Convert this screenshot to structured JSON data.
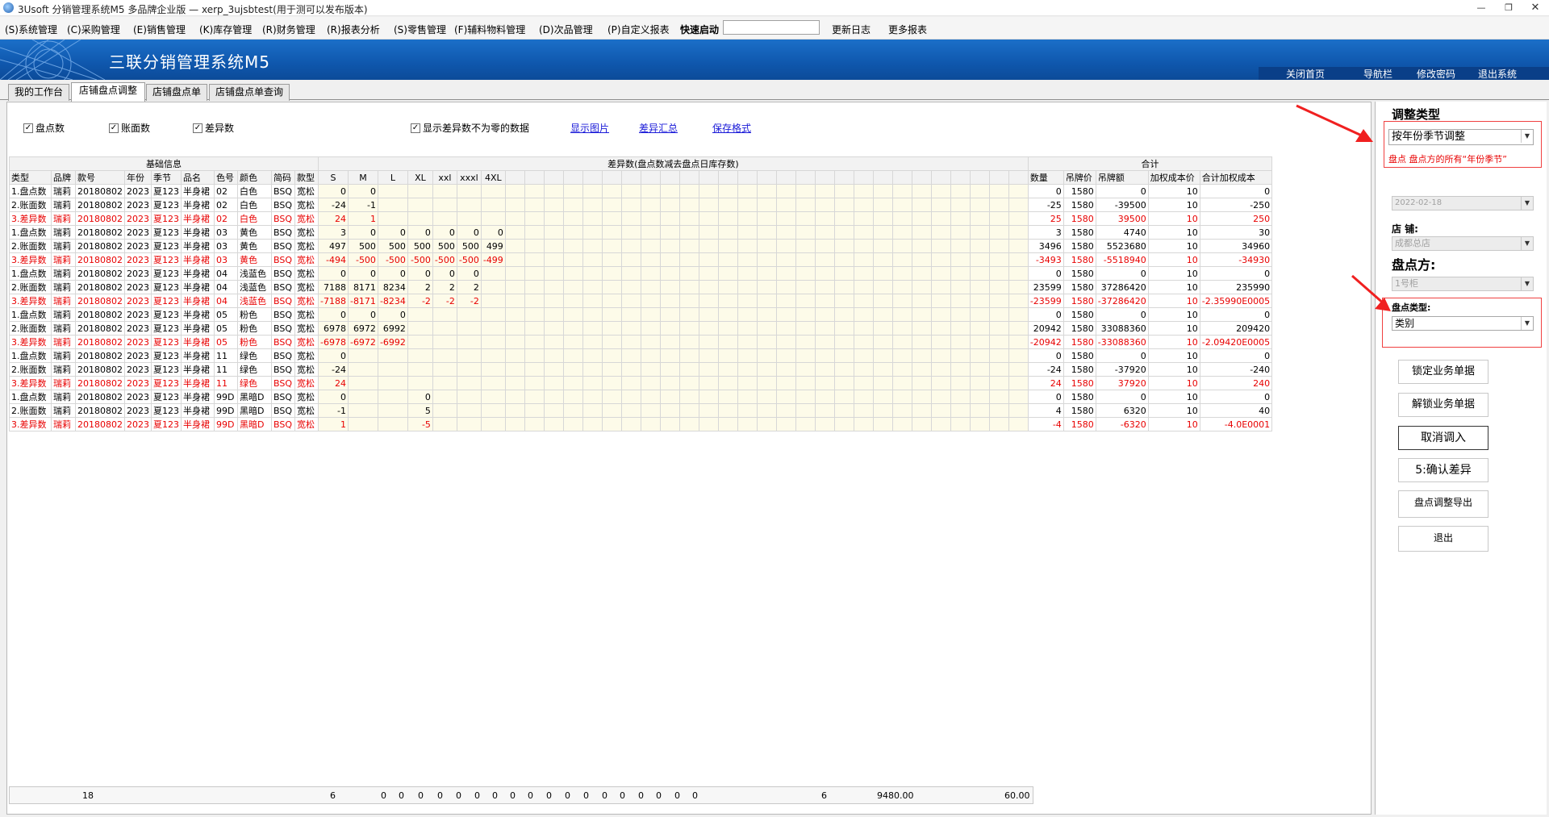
{
  "window": {
    "title": "3Usoft 分销管理系统M5 多品牌企业版 — xerp_3ujsbtest(用于测可以发布版本)"
  },
  "menu": {
    "items": [
      "(S)系统管理",
      "(C)采购管理",
      "(E)销售管理",
      "(K)库存管理",
      "(R)财务管理",
      "(R)报表分析",
      "(S)零售管理",
      "(F)辅料物料管理",
      "(D)次品管理",
      "(P)自定义报表"
    ],
    "quick_label": "快速启动",
    "quick_value": "",
    "update_log": "更新日志",
    "more_reports": "更多报表"
  },
  "banner": {
    "title": "三联分销管理系统M5",
    "links": [
      "关闭首页",
      "导航栏",
      "修改密码",
      "退出系统"
    ]
  },
  "tabs": [
    "我的工作台",
    "店铺盘点调整",
    "店铺盘点单",
    "店铺盘点单查询"
  ],
  "toolbar": {
    "cb_count": "盘点数",
    "cb_book": "账面数",
    "cb_diff": "差异数",
    "cb_nonzero": "显示差异数不为零的数据",
    "link_pics": "显示图片",
    "link_summary": "差异汇总",
    "link_save": "保存格式"
  },
  "grid": {
    "group_basic": "基础信息",
    "group_diff": "差异数(盘点数减去盘点日库存数)",
    "group_total": "合计",
    "columns": [
      "类型",
      "品牌",
      "款号",
      "年份",
      "季节",
      "品名",
      "色号",
      "颜色",
      "简码",
      "款型",
      "S",
      "M",
      "L",
      "XL",
      "xxl",
      "xxxl",
      "4XL",
      "",
      "",
      "",
      "",
      "",
      "",
      "",
      "",
      "",
      "",
      "",
      "",
      "",
      "",
      "",
      "",
      "",
      "",
      "",
      "",
      "",
      "",
      "",
      "",
      "",
      "",
      "",
      "数量",
      "吊牌价",
      "吊牌额",
      "加权成本价",
      "合计加权成本"
    ],
    "rows": [
      {
        "red": false,
        "cells": [
          "1.盘点数",
          "瑞莉",
          "20180802",
          "2023",
          "夏123",
          "半身裙",
          "02",
          "白色",
          "BSQ",
          "宽松",
          "0",
          "0",
          "",
          "",
          "",
          "",
          "",
          "0",
          "1580",
          "0",
          "10",
          "0"
        ]
      },
      {
        "red": false,
        "cells": [
          "2.账面数",
          "瑞莉",
          "20180802",
          "2023",
          "夏123",
          "半身裙",
          "02",
          "白色",
          "BSQ",
          "宽松",
          "-24",
          "-1",
          "",
          "",
          "",
          "",
          "",
          "-25",
          "1580",
          "-39500",
          "10",
          "-250"
        ]
      },
      {
        "red": true,
        "cells": [
          "3.差异数",
          "瑞莉",
          "20180802",
          "2023",
          "夏123",
          "半身裙",
          "02",
          "白色",
          "BSQ",
          "宽松",
          "24",
          "1",
          "",
          "",
          "",
          "",
          "",
          "25",
          "1580",
          "39500",
          "10",
          "250"
        ]
      },
      {
        "red": false,
        "cells": [
          "1.盘点数",
          "瑞莉",
          "20180802",
          "2023",
          "夏123",
          "半身裙",
          "03",
          "黄色",
          "BSQ",
          "宽松",
          "3",
          "0",
          "0",
          "0",
          "0",
          "0",
          "0",
          "3",
          "1580",
          "4740",
          "10",
          "30"
        ]
      },
      {
        "red": false,
        "cells": [
          "2.账面数",
          "瑞莉",
          "20180802",
          "2023",
          "夏123",
          "半身裙",
          "03",
          "黄色",
          "BSQ",
          "宽松",
          "497",
          "500",
          "500",
          "500",
          "500",
          "500",
          "499",
          "3496",
          "1580",
          "5523680",
          "10",
          "34960"
        ]
      },
      {
        "red": true,
        "cells": [
          "3.差异数",
          "瑞莉",
          "20180802",
          "2023",
          "夏123",
          "半身裙",
          "03",
          "黄色",
          "BSQ",
          "宽松",
          "-494",
          "-500",
          "-500",
          "-500",
          "-500",
          "-500",
          "-499",
          "-3493",
          "1580",
          "-5518940",
          "10",
          "-34930"
        ]
      },
      {
        "red": false,
        "cells": [
          "1.盘点数",
          "瑞莉",
          "20180802",
          "2023",
          "夏123",
          "半身裙",
          "04",
          "浅蓝色",
          "BSQ",
          "宽松",
          "0",
          "0",
          "0",
          "0",
          "0",
          "0",
          "",
          "0",
          "1580",
          "0",
          "10",
          "0"
        ]
      },
      {
        "red": false,
        "cells": [
          "2.账面数",
          "瑞莉",
          "20180802",
          "2023",
          "夏123",
          "半身裙",
          "04",
          "浅蓝色",
          "BSQ",
          "宽松",
          "7188",
          "8171",
          "8234",
          "2",
          "2",
          "2",
          "",
          "23599",
          "1580",
          "37286420",
          "10",
          "235990"
        ]
      },
      {
        "red": true,
        "cells": [
          "3.差异数",
          "瑞莉",
          "20180802",
          "2023",
          "夏123",
          "半身裙",
          "04",
          "浅蓝色",
          "BSQ",
          "宽松",
          "-7188",
          "-8171",
          "-8234",
          "-2",
          "-2",
          "-2",
          "",
          "-23599",
          "1580",
          "-37286420",
          "10",
          "-2.35990E0005"
        ]
      },
      {
        "red": false,
        "cells": [
          "1.盘点数",
          "瑞莉",
          "20180802",
          "2023",
          "夏123",
          "半身裙",
          "05",
          "粉色",
          "BSQ",
          "宽松",
          "0",
          "0",
          "0",
          "",
          "",
          "",
          "",
          "0",
          "1580",
          "0",
          "10",
          "0"
        ]
      },
      {
        "red": false,
        "cells": [
          "2.账面数",
          "瑞莉",
          "20180802",
          "2023",
          "夏123",
          "半身裙",
          "05",
          "粉色",
          "BSQ",
          "宽松",
          "6978",
          "6972",
          "6992",
          "",
          "",
          "",
          "",
          "20942",
          "1580",
          "33088360",
          "10",
          "209420"
        ]
      },
      {
        "red": true,
        "cells": [
          "3.差异数",
          "瑞莉",
          "20180802",
          "2023",
          "夏123",
          "半身裙",
          "05",
          "粉色",
          "BSQ",
          "宽松",
          "-6978",
          "-6972",
          "-6992",
          "",
          "",
          "",
          "",
          "-20942",
          "1580",
          "-33088360",
          "10",
          "-2.09420E0005"
        ]
      },
      {
        "red": false,
        "cells": [
          "1.盘点数",
          "瑞莉",
          "20180802",
          "2023",
          "夏123",
          "半身裙",
          "11",
          "绿色",
          "BSQ",
          "宽松",
          "0",
          "",
          "",
          "",
          "",
          "",
          "",
          "0",
          "1580",
          "0",
          "10",
          "0"
        ]
      },
      {
        "red": false,
        "cells": [
          "2.账面数",
          "瑞莉",
          "20180802",
          "2023",
          "夏123",
          "半身裙",
          "11",
          "绿色",
          "BSQ",
          "宽松",
          "-24",
          "",
          "",
          "",
          "",
          "",
          "",
          "-24",
          "1580",
          "-37920",
          "10",
          "-240"
        ]
      },
      {
        "red": true,
        "cells": [
          "3.差异数",
          "瑞莉",
          "20180802",
          "2023",
          "夏123",
          "半身裙",
          "11",
          "绿色",
          "BSQ",
          "宽松",
          "24",
          "",
          "",
          "",
          "",
          "",
          "",
          "24",
          "1580",
          "37920",
          "10",
          "240"
        ]
      },
      {
        "red": false,
        "cells": [
          "1.盘点数",
          "瑞莉",
          "20180802",
          "2023",
          "夏123",
          "半身裙",
          "99D",
          "黑暗D",
          "BSQ",
          "宽松",
          "0",
          "",
          "",
          "0",
          "",
          "",
          "",
          "0",
          "1580",
          "0",
          "10",
          "0"
        ]
      },
      {
        "red": false,
        "cells": [
          "2.账面数",
          "瑞莉",
          "20180802",
          "2023",
          "夏123",
          "半身裙",
          "99D",
          "黑暗D",
          "BSQ",
          "宽松",
          "-1",
          "",
          "",
          "5",
          "",
          "",
          "",
          "4",
          "1580",
          "6320",
          "10",
          "40"
        ]
      },
      {
        "red": true,
        "cells": [
          "3.差异数",
          "瑞莉",
          "20180802",
          "2023",
          "夏123",
          "半身裙",
          "99D",
          "黑暗D",
          "BSQ",
          "宽松",
          "1",
          "",
          "",
          "-5",
          "",
          "",
          "",
          "-4",
          "1580",
          "-6320",
          "10",
          "-4.0E0001"
        ]
      }
    ],
    "footer": {
      "count": "18",
      "s_total": "6",
      "zeros": "0",
      "qty": "6",
      "amount": "9480.00",
      "cost": "60.00"
    }
  },
  "right_panel": {
    "adjust_type_title": "调整类型",
    "adjust_type_value": "按年份季节调整",
    "note": "盘点 盘点方的所有“年份季节”",
    "date_value": "2022-02-18",
    "store_label": "店  铺:",
    "store_value": "成都总店",
    "count_party_label": "盘点方:",
    "count_party_value": "1号柜",
    "count_type_label": "盘点类型:",
    "count_type_value": "类别",
    "buttons": [
      "锁定业务单据",
      "解锁业务单据",
      "取消调入",
      "5:确认差异",
      "盘点调整导出",
      "退出"
    ]
  },
  "colors": {
    "accent": "#0f57ad",
    "error_red": "#e80000",
    "link_blue": "#1a1ad8",
    "annotation_red": "#f04040"
  }
}
